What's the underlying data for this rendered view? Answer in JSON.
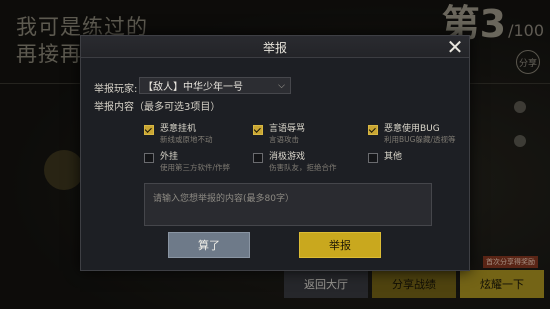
{
  "background": {
    "title_line1": "我可是练过的",
    "title_line2": "再接再",
    "rank_prefix": "第",
    "rank_number": "3",
    "rank_total": "/100",
    "share_label": "分享",
    "bottom_buttons": {
      "return_label": "返回大厅",
      "share_label": "分享战绩",
      "show_label": "炫耀一下",
      "show_tag": "首次分享得奖励"
    }
  },
  "modal": {
    "title": "举报",
    "close_icon": "close-icon",
    "player_label": "举报玩家:",
    "player_value": "【敌人】中华少年一号",
    "content_label": "举报内容（最多可选3项目）",
    "options": [
      {
        "title": "恶意挂机",
        "desc": "新线或原地不动",
        "checked": true
      },
      {
        "title": "言语辱骂",
        "desc": "言语攻击",
        "checked": true
      },
      {
        "title": "恶意使用BUG",
        "desc": "利用BUG躲藏/透视等",
        "checked": true
      },
      {
        "title": "外挂",
        "desc": "使用第三方软件/作弊",
        "checked": false
      },
      {
        "title": "消极游戏",
        "desc": "伤害队友，拒绝合作",
        "checked": false
      },
      {
        "title": "其他",
        "desc": "",
        "checked": false
      }
    ],
    "textarea_placeholder": "请输入您想举报的内容(最多80字）",
    "cancel_label": "算了",
    "submit_label": "举报"
  },
  "colors": {
    "accent_gold": "#c9a81e",
    "cancel_grey_blue": "#6e7a89",
    "modal_bg": "#1d1f24"
  }
}
